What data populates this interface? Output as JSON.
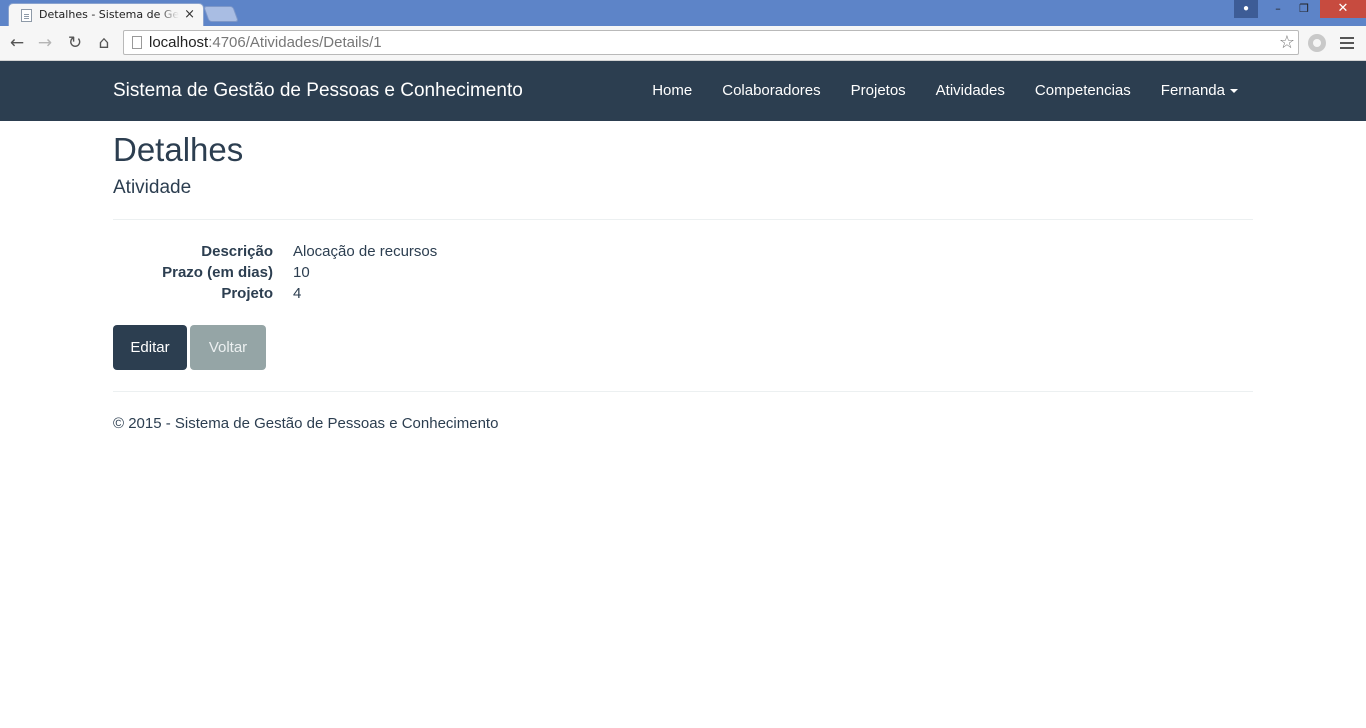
{
  "browser": {
    "tab_title": "Detalhes - Sistema de Gestão de Pessoas e Conhecimento",
    "tab_close": "×",
    "url_host": "localhost",
    "url_path": ":4706/Atividades/Details/1",
    "window_minimize": "–",
    "window_maximize": "❐",
    "window_close": "✕",
    "nav_back": "←",
    "nav_forward": "→",
    "nav_reload": "↻",
    "nav_home": "⌂",
    "star": "☆",
    "user_glyph": "●"
  },
  "navbar": {
    "brand": "Sistema de Gestão de Pessoas e Conhecimento",
    "links": [
      "Home",
      "Colaboradores",
      "Projetos",
      "Atividades",
      "Competencias"
    ],
    "user": "Fernanda"
  },
  "page": {
    "title": "Detalhes",
    "subtitle": "Atividade"
  },
  "details": [
    {
      "label": "Descrição",
      "value": "Alocação de recursos"
    },
    {
      "label": "Prazo (em dias)",
      "value": "10"
    },
    {
      "label": "Projeto",
      "value": "4"
    }
  ],
  "buttons": {
    "edit": "Editar",
    "back": "Voltar"
  },
  "footer": {
    "text": "© 2015 - Sistema de Gestão de Pessoas e Conhecimento"
  },
  "colors": {
    "navbar": "#2c3e50",
    "primary_button": "#2c3e50",
    "default_button": "#95a5a6",
    "titlebar": "#5d84c8",
    "window_close": "#c74b3f"
  }
}
